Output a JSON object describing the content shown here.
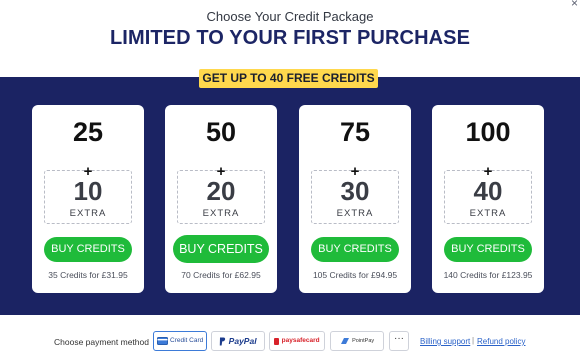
{
  "dialog": {
    "close_symbol": "×"
  },
  "header": {
    "subtitle": "Choose Your Credit Package",
    "headline": "LIMITED TO YOUR FIRST PURCHASE"
  },
  "promo": {
    "text": "GET UP TO 40 FREE CREDITS"
  },
  "packages": [
    {
      "base": "25",
      "plus": "+",
      "extra": "10",
      "extra_label": "EXTRA",
      "button": "BUY CREDITS",
      "price": "35 Credits for £31.95"
    },
    {
      "base": "50",
      "plus": "+",
      "extra": "20",
      "extra_label": "EXTRA",
      "button": "BUY CREDITS",
      "price": "70 Credits for £62.95"
    },
    {
      "base": "75",
      "plus": "+",
      "extra": "30",
      "extra_label": "EXTRA",
      "button": "BUY CREDITS",
      "price": "105 Credits for £94.95"
    },
    {
      "base": "100",
      "plus": "+",
      "extra": "40",
      "extra_label": "EXTRA",
      "button": "BUY CREDITS",
      "price": "140 Credits for £123.95"
    }
  ],
  "footer": {
    "label": "Choose payment method",
    "methods": [
      {
        "name": "Credit Card",
        "icon": "credit-card-icon",
        "selected": true
      },
      {
        "name": "PayPal",
        "icon": "paypal-icon",
        "selected": false
      },
      {
        "name": "paysafecard",
        "icon": "paysafecard-icon",
        "selected": false
      },
      {
        "name": "PointPay",
        "icon": "pointpay-icon",
        "selected": false
      }
    ],
    "more": "···",
    "billing_support": "Billing support",
    "separator": "|",
    "refund_policy": "Refund policy"
  },
  "colors": {
    "band": "#1b2363",
    "headline": "#1c2565",
    "promo": "#ffd84d",
    "buy": "#1fbb3a",
    "link": "#2a62c8"
  }
}
